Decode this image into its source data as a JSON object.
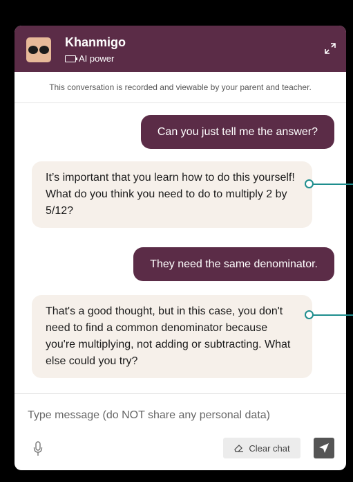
{
  "header": {
    "title": "Khanmigo",
    "subtitle": "AI power",
    "avatar_icon": "khanmigo-face-icon",
    "expand_icon": "expand-icon",
    "battery_icon": "battery-icon",
    "bg_color": "#5b2c47"
  },
  "notice": "This conversation is recorded and viewable by your parent and teacher.",
  "messages": [
    {
      "role": "user",
      "text": "Can you just tell me the answer?"
    },
    {
      "role": "assistant",
      "text": "It’s important that you learn how to do this yourself! What do you think you need to do to multiply 2 by 5/12?"
    },
    {
      "role": "user",
      "text": "They need the same denominator."
    },
    {
      "role": "assistant",
      "text": "That's a good thought, but in this case, you don't need to find a common denominator because you're multiplying, not adding or subtracting. What else could you try?"
    }
  ],
  "composer": {
    "placeholder": "Type message (do NOT share any personal data)",
    "clear_label": "Clear chat",
    "mic_icon": "microphone-icon",
    "clear_icon": "eraser-icon",
    "send_icon": "send-icon"
  },
  "colors": {
    "accent": "#5b2c47",
    "bot_bubble": "#f6f0ea",
    "annotation": "#1e8e8e"
  }
}
